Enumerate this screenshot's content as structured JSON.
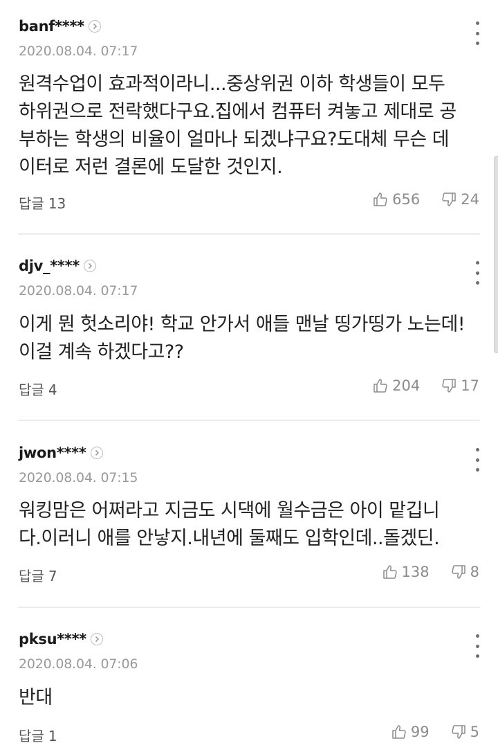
{
  "reply_label": "답글",
  "comments": [
    {
      "author": "banf****",
      "date": "2020.08.04. 07:17",
      "text": "원격수업이 효과적이라니...중상위권 이하 학생들이 모두\n하위권으로 전락했다구요.집에서 컴퓨터 켜놓고 제대로 공\n부하는 학생의 비율이 얼마나 되겠냐구요?도대체 무슨 데\n이터로 저런 결론에 도달한 것인지.",
      "replies": "13",
      "likes": "656",
      "dislikes": "24"
    },
    {
      "author": "djv_****",
      "date": "2020.08.04. 07:17",
      "text": "이게 뭔 헛소리야! 학교 안가서 애들 맨날 띵가띵가 노는데!\n이걸 계속 하겠다고??",
      "replies": "4",
      "likes": "204",
      "dislikes": "17"
    },
    {
      "author": "jwon****",
      "date": "2020.08.04. 07:15",
      "text": "워킹맘은 어쩌라고 지금도 시댁에 월수금은 아이 맡깁니\n다.이러니 애를 안낳지.내년에 둘째도 입학인데..돌겠딘.",
      "replies": "7",
      "likes": "138",
      "dislikes": "8"
    },
    {
      "author": "pksu****",
      "date": "2020.08.04. 07:06",
      "text": "반대",
      "replies": "1",
      "likes": "99",
      "dislikes": "5"
    }
  ]
}
